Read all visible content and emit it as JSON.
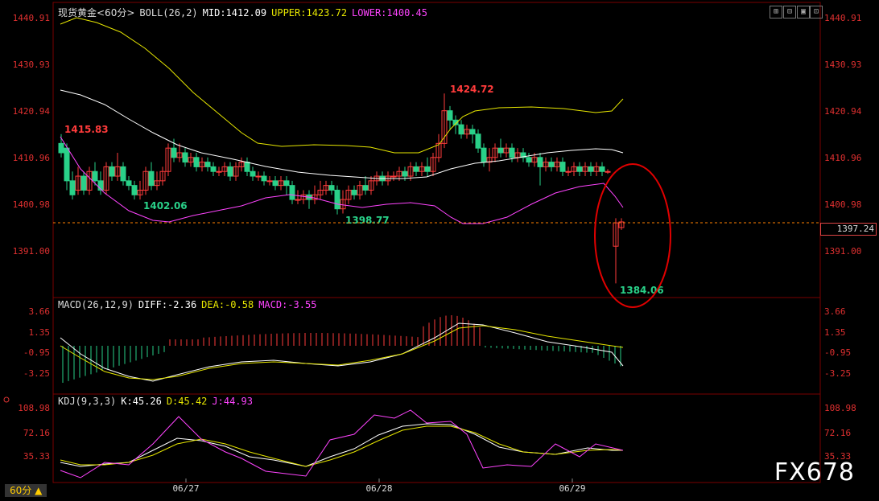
{
  "main_chart": {
    "symbol_label": "现货黄金<60分>",
    "indicator_name": "BOLL(26,2)",
    "mid_text": "MID:1412.09",
    "upper_text": "UPPER:1423.72",
    "lower_text": "LOWER:1400.45",
    "y_ticks": [
      "1440.91",
      "1430.93",
      "1420.94",
      "1410.96",
      "1400.98",
      "1391.00"
    ],
    "current_price": "1397.24",
    "annotations": {
      "high_1": "1415.83",
      "low_1": "1402.06",
      "low_2": "1398.77",
      "high_2": "1424.72",
      "low_3": "1384.06"
    }
  },
  "macd_panel": {
    "indicator_name": "MACD(26,12,9)",
    "diff_text": "DIFF:-2.36",
    "dea_text": "DEA:-0.58",
    "macd_text": "MACD:-3.55",
    "y_ticks": [
      "3.66",
      "1.35",
      "-0.95",
      "-3.25"
    ]
  },
  "kdj_panel": {
    "indicator_name": "KDJ(9,3,3)",
    "k_text": "K:45.26",
    "d_text": "D:45.42",
    "j_text": "J:44.93",
    "y_ticks": [
      "108.98",
      "72.16",
      "35.33"
    ]
  },
  "x_axis": {
    "dates": [
      "06/27",
      "06/28",
      "06/29"
    ]
  },
  "period_button": "60分 ▲",
  "watermark": "FX678",
  "toolbar_icons": [
    "grid-plus-icon",
    "grid-minus-icon",
    "window-icon",
    "expand-icon"
  ],
  "colors": {
    "up": "#ff3b3b",
    "down": "#29d189",
    "boll_mid": "#ffffff",
    "boll_upper": "#e6e600",
    "boll_lower": "#ff44ff",
    "dea": "#e6e600",
    "diff": "#ffffff",
    "grid_line": "#8b0000",
    "accent_yellow": "#ffcc00"
  }
}
